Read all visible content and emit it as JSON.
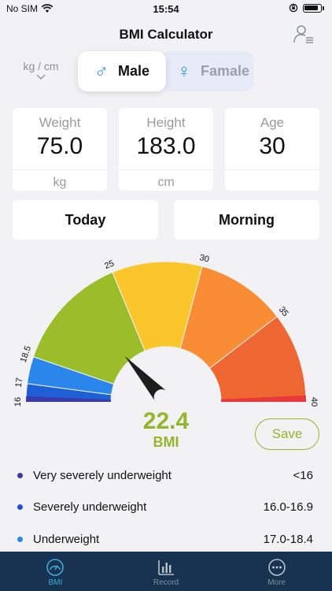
{
  "status": {
    "carrier": "No SIM",
    "time": "15:54"
  },
  "nav": {
    "title": "BMI Calculator"
  },
  "unit_selector": {
    "value": "kg / cm"
  },
  "gender": {
    "male_label": "Male",
    "female_label": "Famale",
    "male_symbol": "♂",
    "female_symbol": "♀"
  },
  "metrics": [
    {
      "label": "Weight",
      "value": "75.0",
      "unit": "kg"
    },
    {
      "label": "Height",
      "value": "183.0",
      "unit": "cm"
    },
    {
      "label": "Age",
      "value": "30",
      "unit": ""
    }
  ],
  "when": {
    "date": "Today",
    "time_of_day": "Morning"
  },
  "gauge": {
    "min": 16,
    "max": 40,
    "value": 22.4,
    "tick_labels": [
      "16",
      "17",
      "18.5",
      "25",
      "30",
      "35",
      "40"
    ],
    "segments": [
      {
        "from": 16,
        "to": 17,
        "color": "#1f5fd6"
      },
      {
        "from": 17,
        "to": 18.5,
        "color": "#2b86ec"
      },
      {
        "from": 18.5,
        "to": 25,
        "color": "#9bbd2a"
      },
      {
        "from": 25,
        "to": 30,
        "color": "#fbc52c"
      },
      {
        "from": 30,
        "to": 35,
        "color": "#f98d35"
      },
      {
        "from": 35,
        "to": 40,
        "color": "#ee6732"
      }
    ]
  },
  "result": {
    "value": "22.4",
    "label": "BMI",
    "color": "#93b62a"
  },
  "save": {
    "label": "Save"
  },
  "legend": [
    {
      "name": "Very severely underweight",
      "range": "<16",
      "color": "#3a3aa8"
    },
    {
      "name": "Severely underweight",
      "range": "16.0-16.9",
      "color": "#1f4fd6"
    },
    {
      "name": "Underweight",
      "range": "17.0-18.4",
      "color": "#2b86ec"
    }
  ],
  "tabs": [
    {
      "label": "BMI",
      "icon": "gauge-icon",
      "active": true
    },
    {
      "label": "Record",
      "icon": "bar-chart-icon",
      "active": false
    },
    {
      "label": "More",
      "icon": "more-icon",
      "active": false
    }
  ]
}
